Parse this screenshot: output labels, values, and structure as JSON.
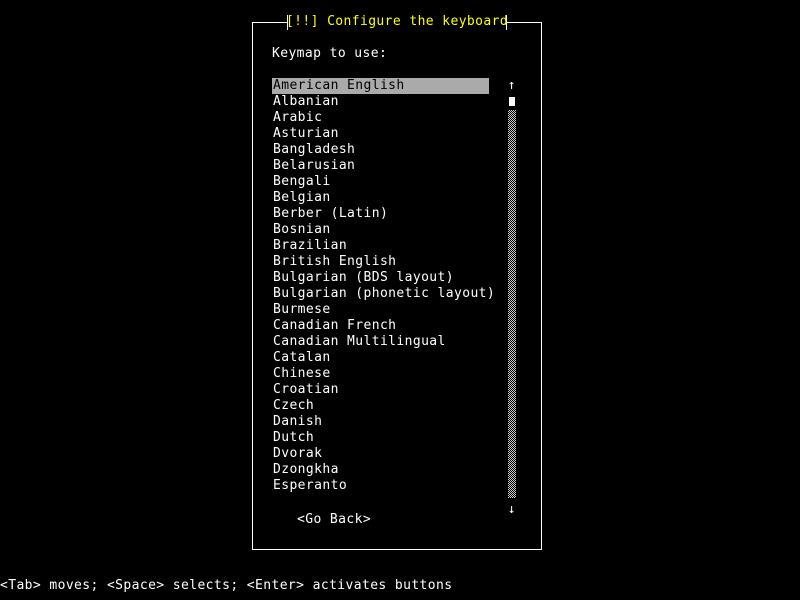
{
  "screen": {
    "background_color": "#000000",
    "foreground_color": "#ffffff",
    "title_color": "#ffff00",
    "highlight_color": "#aaaaaa"
  },
  "dialog": {
    "title": "[!!] Configure the keyboard",
    "prompt": "Keymap to use:"
  },
  "keymap_list": {
    "selected_index": 0,
    "items": [
      "American English",
      "Albanian",
      "Arabic",
      "Asturian",
      "Bangladesh",
      "Belarusian",
      "Bengali",
      "Belgian",
      "Berber (Latin)",
      "Bosnian",
      "Brazilian",
      "British English",
      "Bulgarian (BDS layout)",
      "Bulgarian (phonetic layout)",
      "Burmese",
      "Canadian French",
      "Canadian Multilingual",
      "Catalan",
      "Chinese",
      "Croatian",
      "Czech",
      "Danish",
      "Dutch",
      "Dvorak",
      "Dzongkha",
      "Esperanto"
    ]
  },
  "scrollbar": {
    "up_arrow": "↑",
    "down_arrow": "↓"
  },
  "buttons": {
    "go_back": "<Go Back>"
  },
  "status_bar": {
    "text": "<Tab> moves; <Space> selects; <Enter> activates buttons"
  }
}
